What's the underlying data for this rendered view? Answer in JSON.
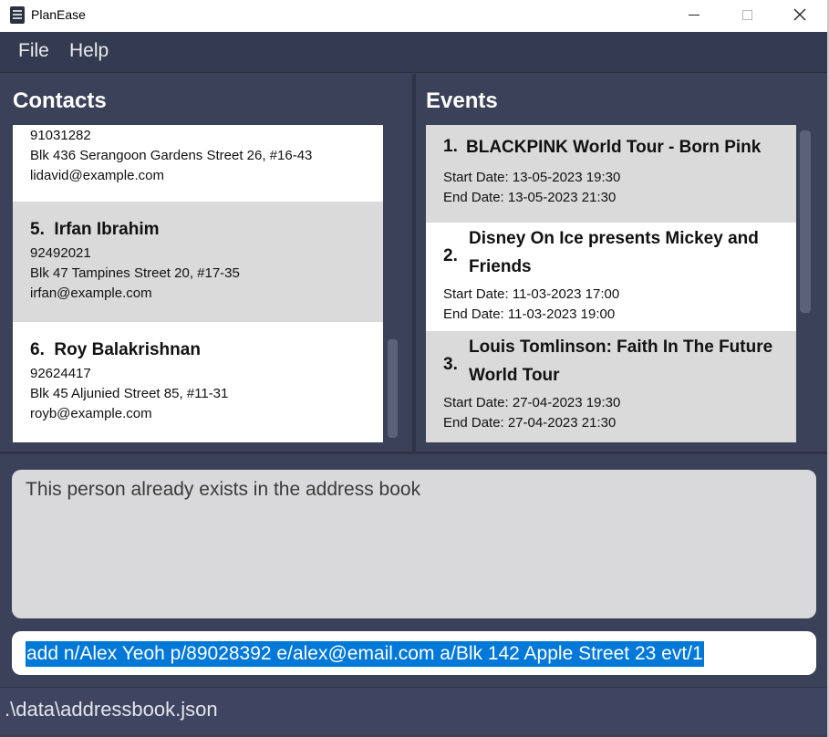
{
  "window": {
    "title": "PlanEase",
    "icon": "notebook-icon",
    "controls": [
      "minimize-icon",
      "maximize-icon",
      "close-icon"
    ]
  },
  "menu": {
    "file": "File",
    "help": "Help"
  },
  "contacts": {
    "title": "Contacts",
    "items": [
      {
        "index": "",
        "name": "",
        "phone": "91031282",
        "address": "Blk 436 Serangoon Gardens Street 26, #16-43",
        "email": "lidavid@example.com"
      },
      {
        "index": "5.",
        "name": "Irfan Ibrahim",
        "phone": "92492021",
        "address": "Blk 47 Tampines Street 20, #17-35",
        "email": "irfan@example.com"
      },
      {
        "index": "6.",
        "name": "Roy Balakrishnan",
        "phone": "92624417",
        "address": "Blk 45 Aljunied Street 85, #11-31",
        "email": "royb@example.com"
      }
    ]
  },
  "events": {
    "title": "Events",
    "items": [
      {
        "index": "1.",
        "name": "BLACKPINK World Tour - Born Pink",
        "start": "Start Date: 13-05-2023 19:30",
        "end": "End Date: 13-05-2023 21:30"
      },
      {
        "index": "2.",
        "name": "Disney On Ice presents Mickey and Friends",
        "start": "Start Date: 11-03-2023 17:00",
        "end": "End Date: 11-03-2023 19:00"
      },
      {
        "index": "3.",
        "name": "Louis Tomlinson: Faith In The Future World Tour",
        "start": "Start Date: 27-04-2023 19:30",
        "end": "End Date: 27-04-2023 21:30"
      }
    ]
  },
  "result": {
    "message": "This person already exists in the address book"
  },
  "command": {
    "value": "add n/Alex Yeoh p/89028392 e/alex@email.com a/Blk 142 Apple Street 23 evt/1"
  },
  "status": {
    "path": ".\\data\\addressbook.json"
  },
  "colors": {
    "app_background": "#3b4158",
    "card_alt": "#dadadb",
    "selection": "#0078d7"
  }
}
